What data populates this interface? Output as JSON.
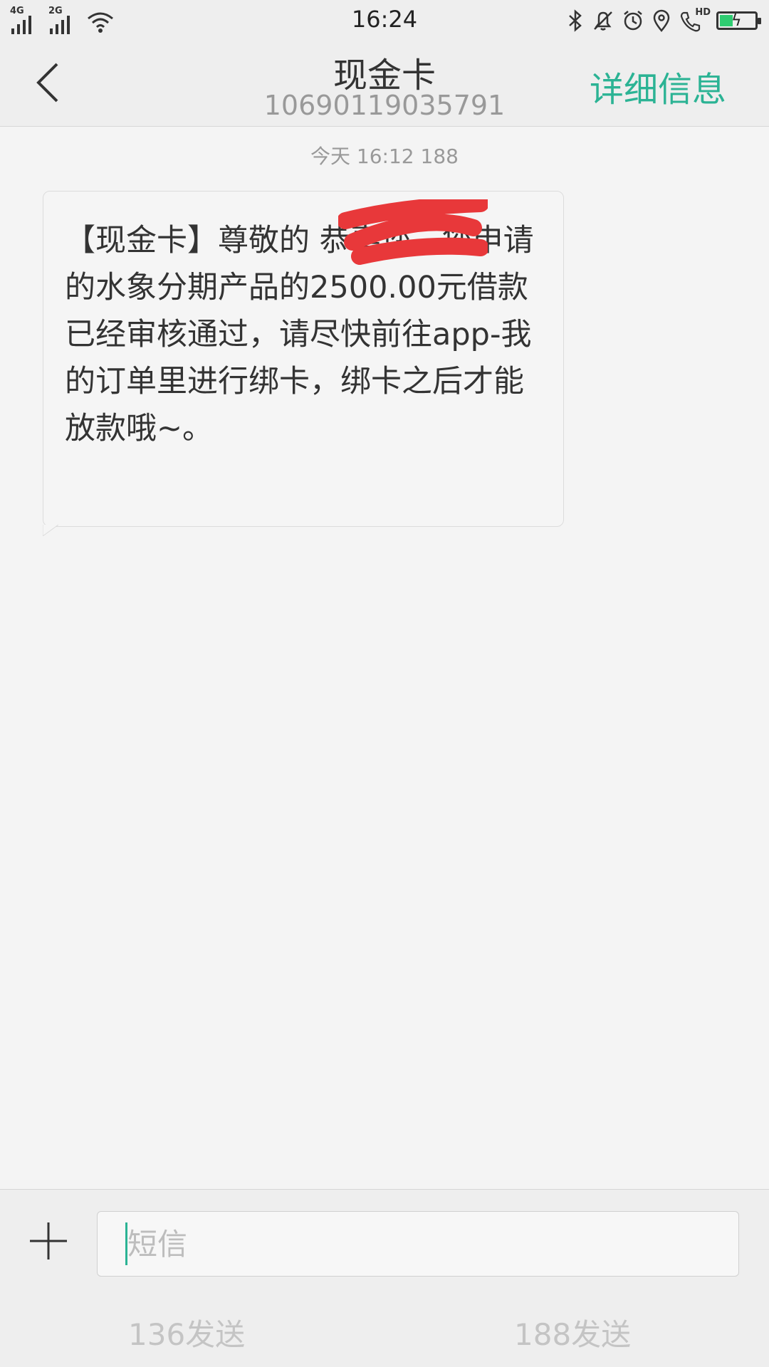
{
  "status_bar": {
    "time": "16:24",
    "network_1": "4G",
    "network_2": "2G",
    "hd_label": "HD",
    "battery_color": "#2ecc71",
    "icons": [
      "signal-icon",
      "signal-icon",
      "wifi-icon",
      "bluetooth-icon",
      "mute-bell-icon",
      "alarm-icon",
      "location-icon",
      "call-hd-icon",
      "battery-charging-icon"
    ]
  },
  "header": {
    "title": "现金卡",
    "number": "10690119035791",
    "detail_label": "详细信息",
    "accent_color": "#2bb394"
  },
  "conversation": {
    "timestamp": "今天 16:12 188",
    "message": "【现金卡】尊敬的 恭喜您，您申请的水象分期产品的2500.00元借款已经审核通过，请尽快前往app-我的订单里进行绑卡，绑卡之后才能放款哦~。"
  },
  "composer": {
    "placeholder": "短信",
    "send_136": "136发送",
    "send_188": "188发送"
  }
}
